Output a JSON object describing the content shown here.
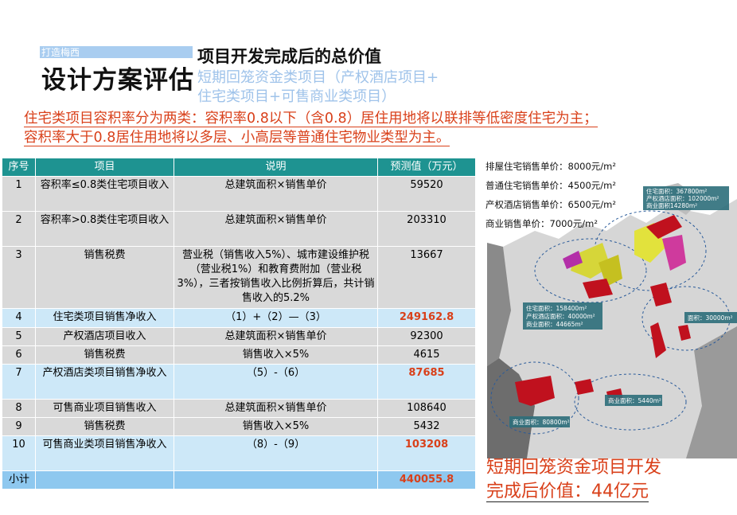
{
  "header": {
    "tag": "打造梅西",
    "section_title": "设计方案评估",
    "main_title": "项目开发完成后的总价值",
    "subtitle_line1": "短期回笼资金类项目（产权酒店项目+",
    "subtitle_line2": "住宅类项目+可售商业类项目）"
  },
  "intro": {
    "line1": "住宅类项目容积率分为两类：容积率0.8以下（含0.8）居住用地将以联排等低密度住宅为主；",
    "line2": "容积率大于0.8居住用地将以多层、小高层等普通住宅物业类型为主。"
  },
  "table": {
    "headers": [
      "序号",
      "项目",
      "说明",
      "预测值（万元）"
    ],
    "rows": [
      {
        "no": "1",
        "item": "容积率≤0.8类住宅项目收入",
        "note": "总建筑面积×销售单价",
        "value": "59520"
      },
      {
        "no": "2",
        "item": "容积率>0.8类住宅项目收入",
        "note": "总建筑面积×销售单价",
        "value": "203310"
      },
      {
        "no": "3",
        "item": "销售税费",
        "note": "营业税（销售收入5%）、城市建设维护税（营业税1%）和教育费附加（营业税3%），三者按销售收入比例折算后，共计销售收入的5.2%",
        "value": "13667"
      },
      {
        "no": "4",
        "item": "住宅类项目销售净收入",
        "note": "（1）+（2）—（3）",
        "value": "249162.8"
      },
      {
        "no": "5",
        "item": "产权酒店项目收入",
        "note": "总建筑面积×销售单价",
        "value": "92300"
      },
      {
        "no": "6",
        "item": "销售税费",
        "note": "销售收入×5%",
        "value": "4615"
      },
      {
        "no": "7",
        "item": "产权酒店类项目销售净收入",
        "note": "（5）-（6）",
        "value": "87685"
      },
      {
        "no": "8",
        "item": "可售商业项目销售收入",
        "note": "总建筑面积×销售单价",
        "value": "108640"
      },
      {
        "no": "9",
        "item": "销售税费",
        "note": "销售收入×5%",
        "value": "5432"
      },
      {
        "no": "10",
        "item": "可售商业类项目销售净收入",
        "note": "（8）-（9）",
        "value": "103208"
      }
    ],
    "total_label": "小计",
    "total_value": "440055.8"
  },
  "prices": {
    "p1": "排屋住宅销售单价：8000元/m²",
    "p2": "普通住宅销售单价：4500元/m²",
    "p3": "产权酒店销售单价：6500元/m²",
    "p4": "商业销售单价：7000元/m²"
  },
  "map": {
    "box1_l1": "住宅面积：367800m²",
    "box1_l2": "产权酒店面积：102000m²",
    "box1_l3": "商业面积14280m²",
    "box2_l1": "住宅面积：158400m²",
    "box2_l2": "产权酒店面积：40000m²",
    "box2_l3": "商业面积：44665m²",
    "box3": "面积：30000m²",
    "box4": "商业面积：5440m²",
    "box5": "商业面积：80800m²"
  },
  "result": {
    "line1": "短期回笼资金项目开发",
    "line2": "完成后价值：44亿元"
  }
}
